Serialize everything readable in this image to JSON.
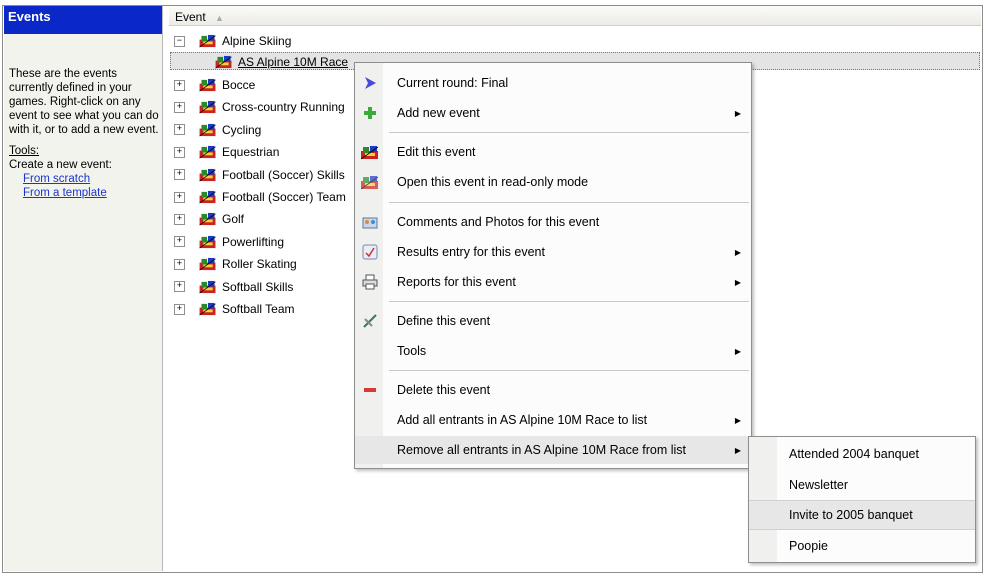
{
  "left_pane": {
    "title": "Events",
    "description": "These are the events currently defined in your games. Right-click on any event to see what you can do with it, or to add a new event.",
    "tools_header": "Tools:",
    "tools_subheader": "Create a new event:",
    "links": [
      "From scratch",
      "From a template"
    ]
  },
  "tree": {
    "column_header": "Event",
    "sort_indicator": "▲",
    "parent": "Alpine Skiing",
    "selected_child": "AS Alpine 10M Race",
    "events": [
      "Bocce",
      "Cross-country Running",
      "Cycling",
      "Equestrian",
      "Football (Soccer) Skills",
      "Football (Soccer) Team",
      "Golf",
      "Powerlifting",
      "Roller Skating",
      "Softball Skills",
      "Softball Team"
    ]
  },
  "context_menu": {
    "items": [
      {
        "label": "Current round: Final",
        "icon": "chevron-right-icon",
        "submenu": false
      },
      {
        "label": "Add new event",
        "icon": "plus-icon",
        "submenu": true
      },
      {
        "label": "Edit this event",
        "icon": "event-icon",
        "submenu": false
      },
      {
        "label": "Open this event in read-only mode",
        "icon": "event-readonly-icon",
        "submenu": false
      },
      {
        "label": "Comments and Photos for this event",
        "icon": "photos-icon",
        "submenu": false
      },
      {
        "label": "Results entry for this event",
        "icon": "results-icon",
        "submenu": true
      },
      {
        "label": "Reports for this event",
        "icon": "printer-icon",
        "submenu": true
      },
      {
        "label": "Define this event",
        "icon": "define-icon",
        "submenu": false
      },
      {
        "label": "Tools",
        "icon": "",
        "submenu": true
      },
      {
        "label": "Delete this event",
        "icon": "minus-icon",
        "submenu": false
      },
      {
        "label": "Add all entrants in AS Alpine 10M Race to list",
        "icon": "",
        "submenu": true
      },
      {
        "label": "Remove all entrants in AS Alpine 10M Race from list",
        "icon": "",
        "submenu": true
      }
    ]
  },
  "submenu": {
    "items": [
      "Attended 2004 banquet",
      "Newsletter",
      "Invite to 2005 banquet",
      "Poopie"
    ],
    "highlighted": "Invite to 2005 banquet"
  },
  "colors": {
    "title_bar": "#0a28c8",
    "link": "#1a35c8",
    "delete_icon": "#d83a3a",
    "add_icon": "#3aaa3a"
  }
}
